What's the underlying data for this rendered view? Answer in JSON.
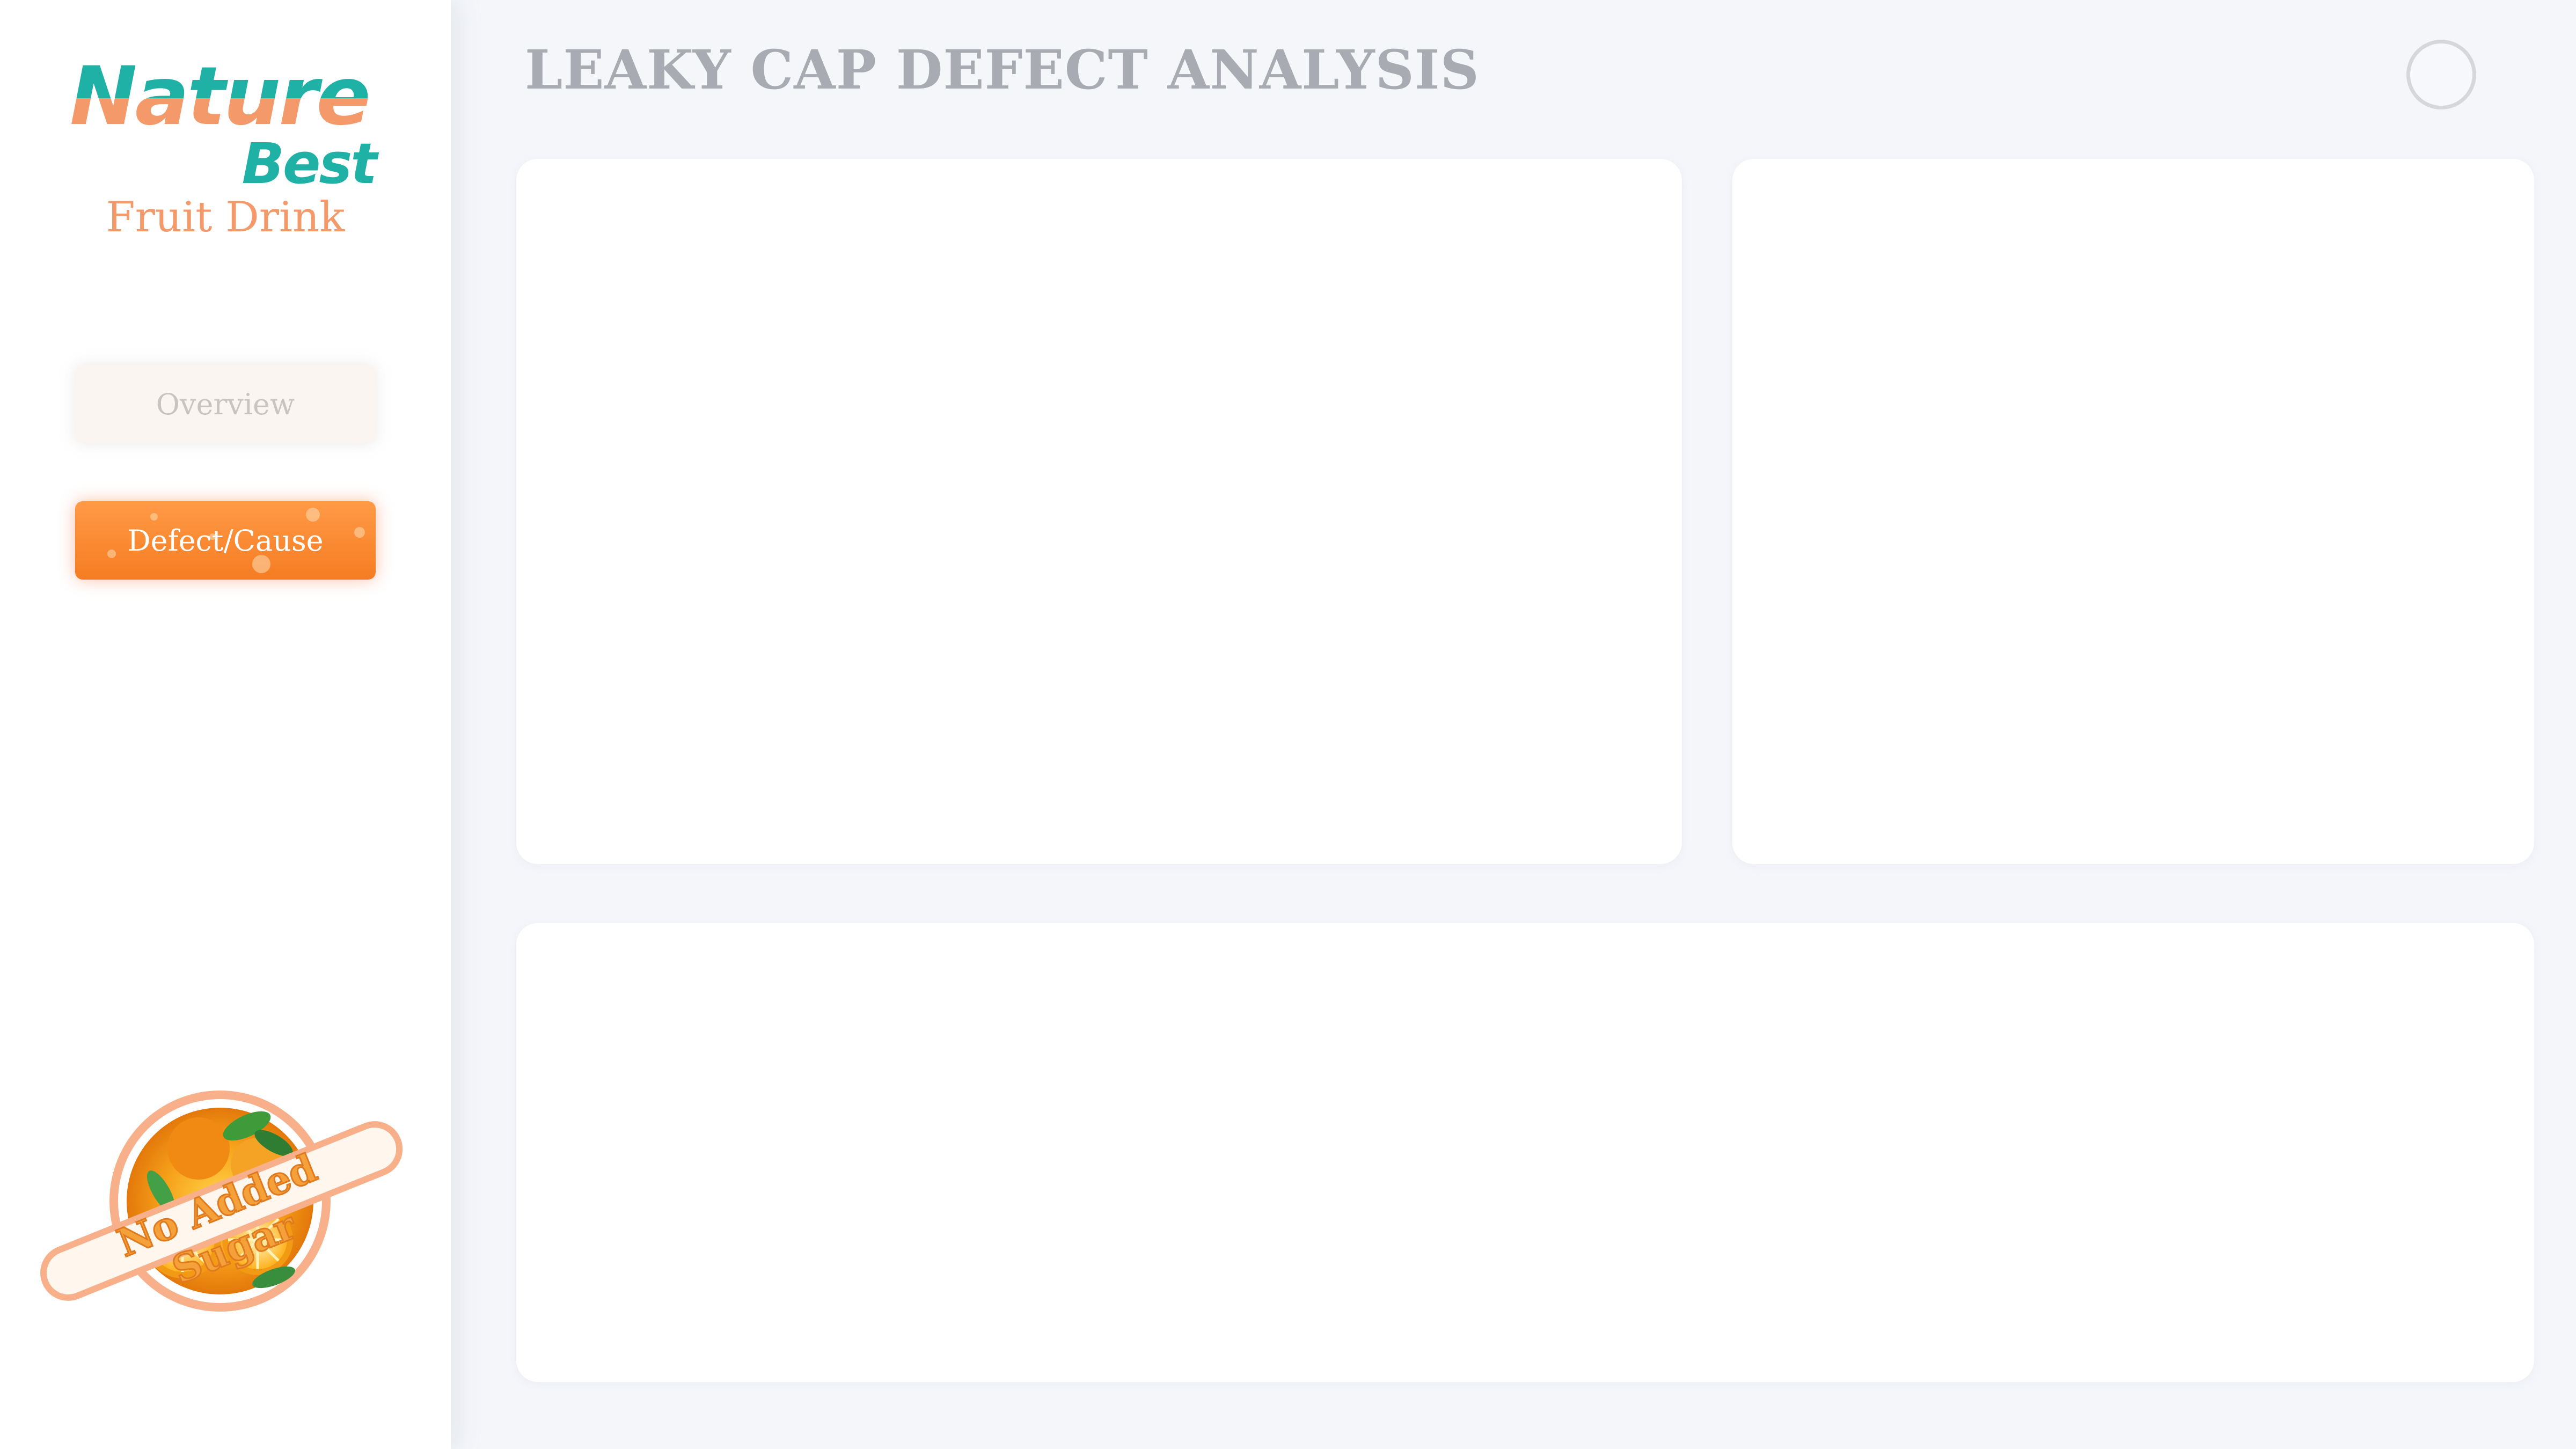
{
  "brand": {
    "name": "Nature's",
    "name_second": "Best",
    "product": "Fruit Drink",
    "badge_text": "No Added Sugar",
    "colors": {
      "teal": "#1fb1a6",
      "peach": "#f4996a",
      "orange": "#f57c22"
    }
  },
  "sidebar": {
    "items": [
      {
        "label": "Overview",
        "active": false
      },
      {
        "label": "Defect/Cause",
        "active": true
      }
    ]
  },
  "header": {
    "title": "LEAKY CAP DEFECT ANALYSIS",
    "action_icon": "circle-icon"
  },
  "main": {
    "panels": [
      {
        "id": "panel-top-left"
      },
      {
        "id": "panel-top-right"
      },
      {
        "id": "panel-bottom"
      }
    ]
  }
}
